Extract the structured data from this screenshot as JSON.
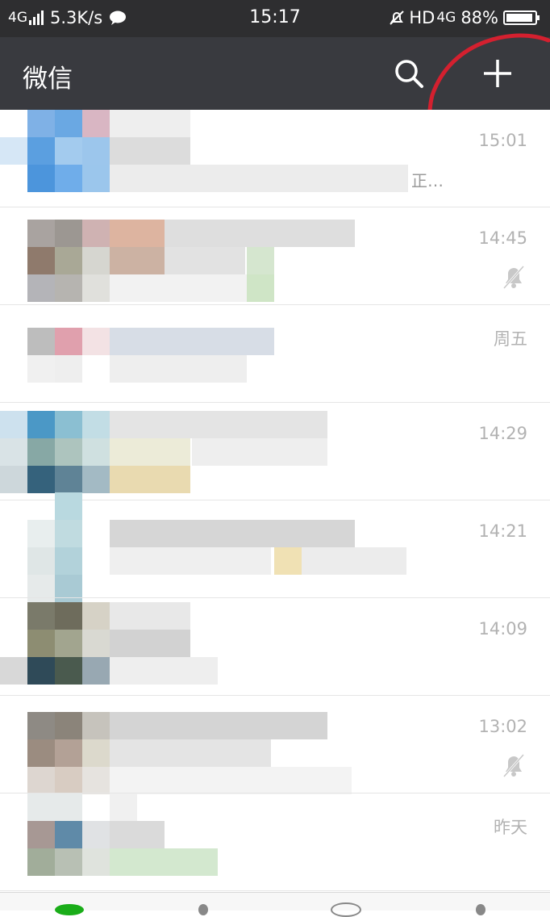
{
  "status_bar": {
    "network_left": "4G",
    "speed": "5.3K/s",
    "time": "15:17",
    "hd": "HD",
    "network_right": "4G",
    "battery": "88%",
    "icons": [
      "signal-bars-icon",
      "wechat-notification-icon",
      "alarm-muted-icon",
      "battery-icon"
    ]
  },
  "nav": {
    "title": "微信",
    "search_icon": "search-icon",
    "add_icon": "plus-icon",
    "annotation_color": "#d4202f"
  },
  "chats": [
    {
      "time": "15:01",
      "muted": false,
      "preview_fragment": "正…"
    },
    {
      "time": "14:45",
      "muted": true
    },
    {
      "time": "周五",
      "muted": false
    },
    {
      "time": "14:29",
      "muted": false
    },
    {
      "time": "14:21",
      "muted": false
    },
    {
      "time": "14:09",
      "muted": false
    },
    {
      "time": "13:02",
      "muted": true
    },
    {
      "time": "昨天",
      "muted": false
    }
  ],
  "colors": {
    "status_bar_bg": "#2e2e30",
    "nav_bg": "#393a3f",
    "time_text": "#b2b2b2",
    "tab_accent": "#1aad19"
  }
}
